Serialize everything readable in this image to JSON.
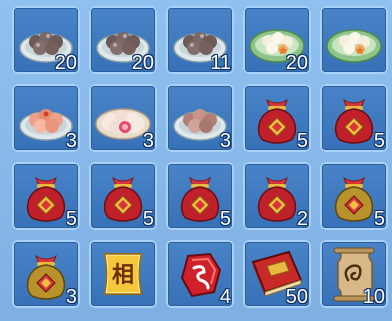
{
  "inventory": {
    "slots": [
      {
        "icon": "dark-dumpling-plate-icon",
        "count": "20"
      },
      {
        "icon": "dark-dumpling-plate-icon",
        "count": "20"
      },
      {
        "icon": "dark-dumpling-plate-icon",
        "count": "11"
      },
      {
        "icon": "white-dumpling-plate-icon",
        "count": "20"
      },
      {
        "icon": "white-dumpling-plate-icon",
        "count": ""
      },
      {
        "icon": "peach-dumpling-plate-icon",
        "count": "3"
      },
      {
        "icon": "flower-dumpling-plate-icon",
        "count": "3"
      },
      {
        "icon": "brown-dumpling-plate-icon",
        "count": "3"
      },
      {
        "icon": "red-lucky-bag-icon",
        "count": "5"
      },
      {
        "icon": "red-lucky-bag-icon",
        "count": "5"
      },
      {
        "icon": "red-lucky-bag-icon",
        "count": "5"
      },
      {
        "icon": "red-lucky-bag-icon",
        "count": "5"
      },
      {
        "icon": "red-lucky-bag-icon",
        "count": "5"
      },
      {
        "icon": "red-lucky-bag-icon",
        "count": "2"
      },
      {
        "icon": "gold-lucky-bag-icon",
        "count": "5"
      },
      {
        "icon": "gold-lucky-bag-icon",
        "count": "3"
      },
      {
        "icon": "xiang-scroll-icon",
        "count": "",
        "glyph": "相"
      },
      {
        "icon": "red-rune-stone-icon",
        "count": "4"
      },
      {
        "icon": "red-book-icon",
        "count": "50"
      },
      {
        "icon": "parchment-scroll-icon",
        "count": "10"
      }
    ]
  }
}
